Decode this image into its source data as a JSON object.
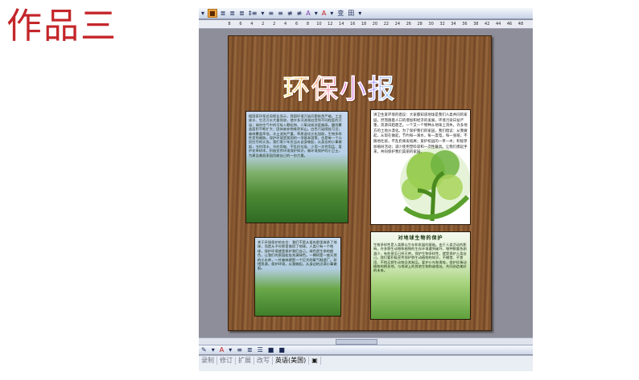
{
  "slide": {
    "title": "作品三"
  },
  "toolbar": {
    "items": [
      "▾",
      "■",
      "≣",
      "≣",
      "≣",
      "‡≡",
      "▾",
      "≡",
      "≡",
      "≢",
      "≢",
      "A",
      "▾",
      "A",
      "▾",
      "变",
      "田",
      "▾"
    ]
  },
  "ruler": {
    "ticks": [
      "8",
      "6",
      "4",
      "2",
      "2",
      "4",
      "6",
      "8",
      "10",
      "12",
      "14",
      "16",
      "18",
      "20",
      "22",
      "24",
      "26",
      "28",
      "30",
      "32",
      "34",
      "36",
      "38",
      "42",
      "44",
      "46",
      "48"
    ]
  },
  "document": {
    "wordart_title": "环保小报",
    "box_top_left": {
      "text": "据国家环保总局报告显示，我国环境污染问题依然严峻。工业废水、生活污水大量排放，使许多河流湖泊受到不同程度的污染；城市空气中的可吸入颗粒物、二氧化硫浓度偏高，酸雨覆盖面积不断扩大；固体废弃物堆积如山，白色污染随处可见；森林覆盖率低，水土流失严重，草原退化沙化加剧，生物多样性受到威胁。保护环境是我国的一项基本国策，也是每一个公民应尽的义务。我们青少年应当从自身做起，从身边的小事做起，节约用水、节约用电、不乱扔垃圾、少用一次性用品、爱护花草树木，积极宣传环境保护知识，做环境保护的小卫士，为建设美丽家园贡献自己的一份力量。"
    },
    "box_top_right": {
      "text": "讲卫生爱环境的倡议：大家都知道地球是我们人类共同的家园，然而随着人口的增加和经济的发展，环境污染日益严重，资源日趋匮乏。一个又一个物种从地球上消失，许多地方的土地沙漠化。为了保护我们的家园，我们倡议：从我做起，从现在做起，节约每一滴水，每一度电，每一张纸；不随地吐痰，不乱扔果皮纸屑；爱护校园的一草一木；积极参加植树活动；减少使用塑料袋和一次性餐具。让我们携起手来，共同保护我们美丽的家园。"
    },
    "box_bottom_left": {
      "text": "关于环境保护的名言：我们不是从祖先那里继承了地球，而是从子孙那里借用了地球。人类只有一个地球，保护环境就是保护我们自己。绿色是生命的颜色，让我们的家园处处充满绿色。一棵树是一座天然的小水库，一片森林就是一个巨大的氧气制造厂。珍惜资源，保护环境，从我做起，从身边的点滴小事做起。"
    },
    "box_bottom_right": {
      "title": "对地球生物的保护",
      "text": "生物多样性是人类赖以生存和发展的基础。由于人类活动的影响，许多野生动物和植物的生存环境遭到破坏，物种数量急剧减少，有些甚至已经灭绝。保护生物多样性，就是保护人类自己。我们要积极宣传保护野生动植物的知识，不捕猎、不食用、不购买野生动物及其制品，爱护小鸟和青蛙，保护珍稀动植物的栖息地，与地球上的其他生物和谐相处，共同创造美好的未来。"
    }
  },
  "drawbar": {
    "items": [
      "✎",
      "▾",
      "A",
      "▾",
      "≡",
      "≣",
      "☰",
      "■",
      "■"
    ]
  },
  "statusbar": {
    "items": [
      "录制",
      "修订",
      "扩展",
      "改写"
    ],
    "language": "英语(美国)",
    "extra": "▣"
  },
  "colors": {
    "slide_title": "#c4262a",
    "wood": "#8e5e35",
    "chrome": "#c8d3e6",
    "workspace": "#8e8e9a"
  }
}
